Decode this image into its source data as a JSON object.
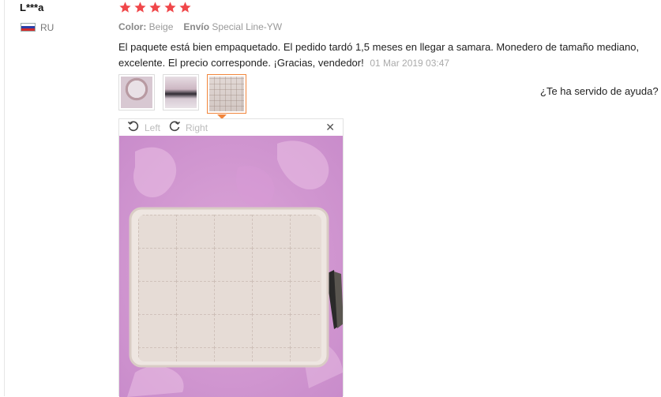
{
  "reviewer": {
    "name": "L***a",
    "country_code": "RU"
  },
  "rating": {
    "stars": 5,
    "max": 5,
    "color": "#f0474a"
  },
  "attributes": {
    "color_label": "Color:",
    "color_value": "Beige",
    "shipping_label": "Envío",
    "shipping_value": "Special Line-YW"
  },
  "review": {
    "text": "El paquete está bien empaquetado. El pedido tardó 1,5 meses en llegar a samara. Monedero de tamaño mediano, excelente. El precio corresponde. ¡Gracias, vendedor!",
    "date": "01 Mar 2019 03:47"
  },
  "thumbnails": [
    {
      "name": "photo-1"
    },
    {
      "name": "photo-2"
    },
    {
      "name": "photo-3",
      "active": true
    }
  ],
  "helpful": {
    "question": "¿Te ha servido de ayuda?"
  },
  "viewer": {
    "rotate_left_label": "Left",
    "rotate_right_label": "Right",
    "close_symbol": "✕"
  },
  "colors": {
    "accent": "#f1853b",
    "star": "#f0474a"
  }
}
